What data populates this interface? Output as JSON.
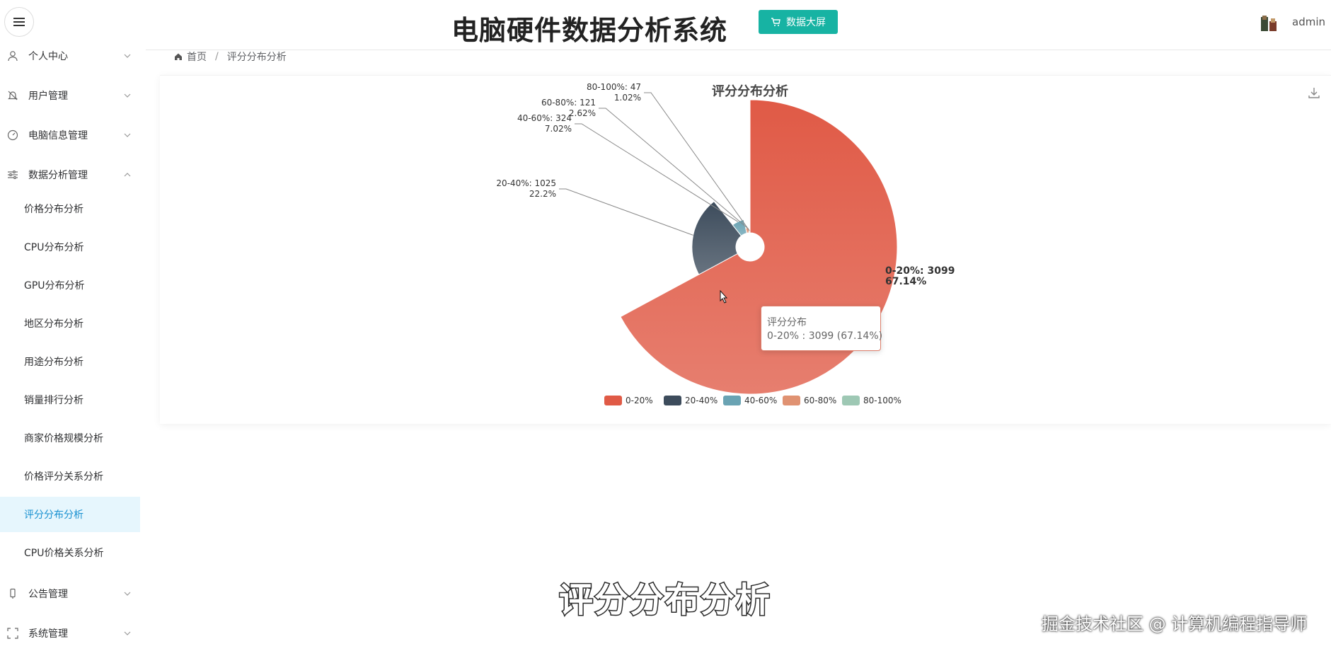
{
  "header": {
    "title": "电脑硬件数据分析系统",
    "datascreen_label": "数据大屏",
    "username": "admin"
  },
  "sidebar": {
    "items": [
      {
        "label": "个人中心",
        "icon": "user-icon"
      },
      {
        "label": "用户管理",
        "icon": "bell-icon"
      },
      {
        "label": "电脑信息管理",
        "icon": "dashboard-icon"
      },
      {
        "label": "数据分析管理",
        "icon": "sliders-icon"
      },
      {
        "label": "公告管理",
        "icon": "phone-icon"
      },
      {
        "label": "系统管理",
        "icon": "fullscreen-icon"
      }
    ],
    "sub_items": [
      "价格分布分析",
      "CPU分布分析",
      "GPU分布分析",
      "地区分布分析",
      "用途分布分析",
      "销量排行分析",
      "商家价格规模分析",
      "价格评分关系分析",
      "评分分布分析",
      "CPU价格关系分析"
    ],
    "active_sub": "评分分布分析"
  },
  "breadcrumb": {
    "home": "首页",
    "current": "评分分布分析"
  },
  "tooltip": {
    "title": "评分分布",
    "value": "0-20% : 3099 (67.14%)"
  },
  "chart_data": {
    "type": "pie",
    "subtype": "rose",
    "title": "评分分布分析",
    "series_name": "评分分布",
    "categories": [
      "0-20%",
      "20-40%",
      "40-60%",
      "60-80%",
      "80-100%"
    ],
    "values": [
      3099,
      1025,
      324,
      121,
      47
    ],
    "percent_labels": [
      "67.14%",
      "22.2%",
      "7.02%",
      "2.62%",
      "1.02%"
    ],
    "labels": [
      "0-20%: 3099",
      "20-40%: 1025",
      "40-60%: 324",
      "60-80%: 121",
      "80-100%: 47"
    ],
    "colors": [
      "#e05a46",
      "#3d4c5c",
      "#6aa3b3",
      "#e09272",
      "#9ec8b4"
    ],
    "legend_position": "bottom"
  },
  "caption": "评分分布分析",
  "watermark": "掘金技术社区 @ 计算机编程指导师"
}
